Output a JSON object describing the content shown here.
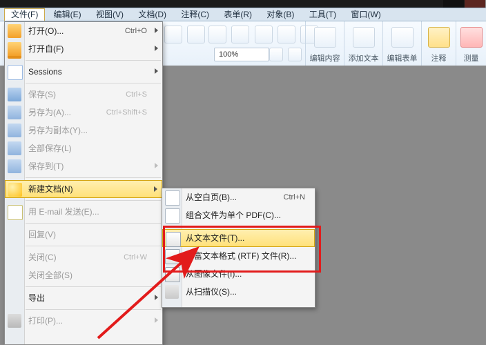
{
  "menu_bar": {
    "items": [
      "文件(F)",
      "编辑(E)",
      "视图(V)",
      "文档(D)",
      "注释(C)",
      "表单(R)",
      "对象(B)",
      "工具(T)",
      "窗口(W)"
    ]
  },
  "ribbon": {
    "zoom_value": "100%",
    "groups": {
      "edit_content": "编辑内容",
      "add_text": "添加文本",
      "edit_form": "编辑表单",
      "annotate": "注释",
      "measure": "测量"
    }
  },
  "file_menu": {
    "open": {
      "label": "打开(O)...",
      "shortcut": "Ctrl+O",
      "has_sub": true
    },
    "open_from": {
      "label": "打开自(F)",
      "has_sub": true
    },
    "sessions": {
      "label": "Sessions",
      "has_sub": true
    },
    "save": {
      "label": "保存(S)",
      "shortcut": "Ctrl+S"
    },
    "save_as": {
      "label": "另存为(A)...",
      "shortcut": "Ctrl+Shift+S"
    },
    "save_copy": {
      "label": "另存为副本(Y)..."
    },
    "save_all": {
      "label": "全部保存(L)"
    },
    "save_to": {
      "label": "保存到(T)",
      "has_sub": true
    },
    "new_doc": {
      "label": "新建文档(N)",
      "has_sub": true
    },
    "email": {
      "label": "用 E-mail 发送(E)..."
    },
    "revert": {
      "label": "回复(V)"
    },
    "close": {
      "label": "关闭(C)",
      "shortcut": "Ctrl+W"
    },
    "close_all": {
      "label": "关闭全部(S)"
    },
    "export": {
      "label": "导出",
      "has_sub": true
    },
    "print": {
      "label": "打印(P)...",
      "has_sub": true
    }
  },
  "new_doc_submenu": {
    "blank": {
      "label": "从空白页(B)...",
      "shortcut": "Ctrl+N"
    },
    "combine": {
      "label": "组合文件为单个 PDF(C)..."
    },
    "from_txt": {
      "label": "从文本文件(T)..."
    },
    "from_rtf": {
      "label": "从富文本格式 (RTF) 文件(R)..."
    },
    "from_img": {
      "label": "从图像文件(I)..."
    },
    "from_scan": {
      "label": "从扫描仪(S)..."
    }
  }
}
